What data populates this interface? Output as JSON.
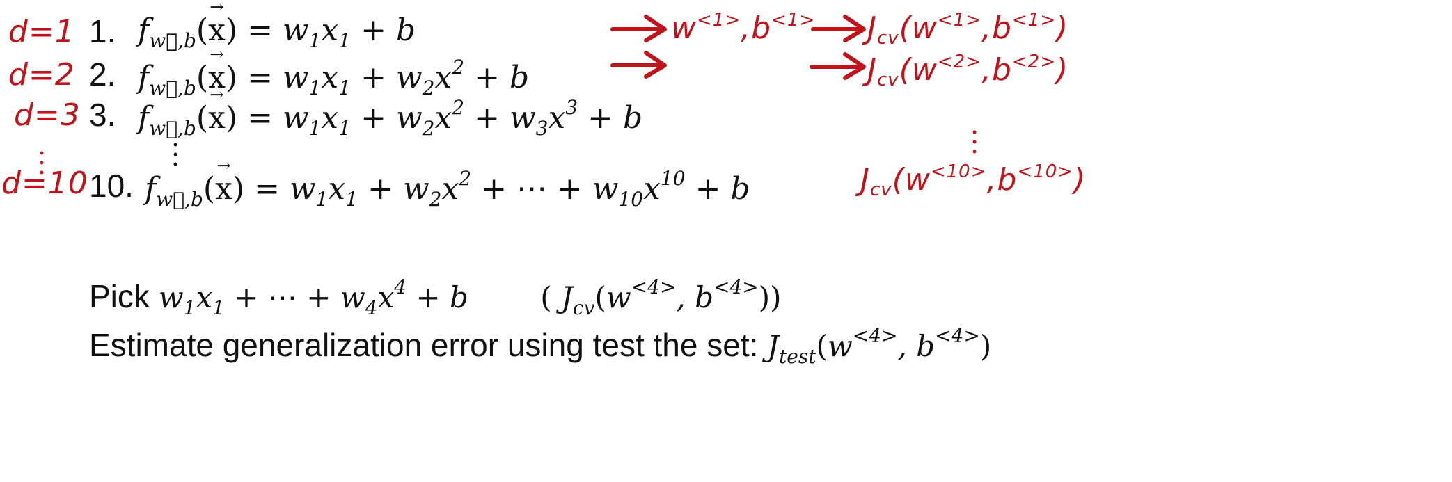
{
  "colors": {
    "annotation": "#c0141c",
    "text": "#111111",
    "background": "#ffffff"
  },
  "degrees": [
    "d=1",
    "d=2",
    "d=3",
    "d=10"
  ],
  "rows": [
    {
      "number": "1.",
      "rhs_tail": "+ b"
    },
    {
      "number": "2.",
      "rhs_tail": "+ b"
    },
    {
      "number": "3.",
      "rhs_tail": "+ b"
    },
    {
      "number": "10.",
      "rhs_tail": "+ b"
    }
  ],
  "annotations": {
    "row1_params": "w<1>,b<1>",
    "row1_cost": "Jcv(w<1>,b<1>)",
    "row2_cost": "Jcv(w<2>,b<2>)",
    "row10_cost": "Jcv(w<10>,b<10>)"
  },
  "bottom": {
    "pick_label": "Pick",
    "estimate_label": "Estimate generalization error using test the set:"
  }
}
